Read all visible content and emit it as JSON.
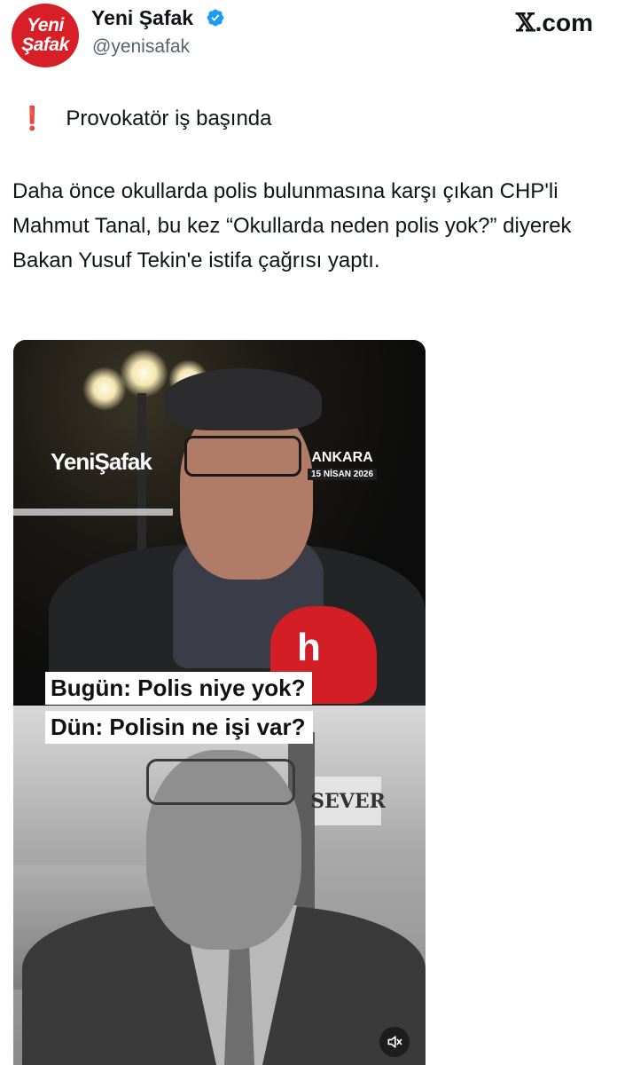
{
  "header": {
    "avatar_text_line1": "Yeni",
    "avatar_text_line2": "Şafak",
    "display_name": "Yeni Şafak",
    "handle": "@yenisafak",
    "site_x": "𝕏",
    "site_rest": ".com",
    "verified_icon": "verified-badge-icon",
    "brand_color": "#d81e26"
  },
  "post": {
    "headline_icon": "❗",
    "headline": "Provokatör iş başında",
    "body": "Daha önce okullarda polis bulunmasına karşı çıkan CHP'li Mahmut Tanal, bu kez “Okullarda neden polis yok?” diyerek Bakan Yusuf Tekin'e istifa çağrısı yaptı."
  },
  "media": {
    "watermark": "YeniŞafak",
    "city": "ANKARA",
    "date": "15 NİSAN 2026",
    "mic_logo": "h",
    "caption_top": "Bugün: Polis niye yok?",
    "caption_bottom": "Dün: Polisin ne işi var?",
    "shop_sign": "SEVER",
    "sound_icon": "speaker-muted-icon"
  }
}
